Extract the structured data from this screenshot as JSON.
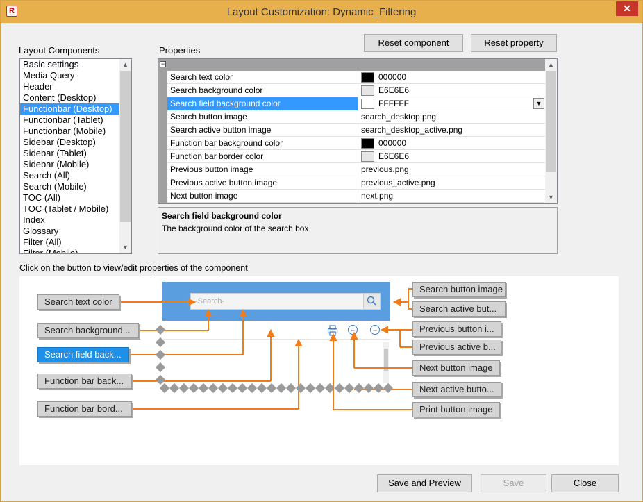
{
  "window": {
    "title": "Layout Customization: Dynamic_Filtering",
    "app_icon_letter": "R",
    "close_glyph": "✕"
  },
  "layout_components": {
    "label": "Layout Components",
    "items": [
      "Basic settings",
      "Media Query",
      "Header",
      "Content (Desktop)",
      "Functionbar (Desktop)",
      "Functionbar (Tablet)",
      "Functionbar (Mobile)",
      "Sidebar (Desktop)",
      "Sidebar (Tablet)",
      "Sidebar (Mobile)",
      "Search (All)",
      "Search (Mobile)",
      "TOC (All)",
      "TOC (Tablet / Mobile)",
      "Index",
      "Glossary",
      "Filter (All)",
      "Filter (Mobile)"
    ],
    "selected": "Functionbar (Desktop)"
  },
  "properties": {
    "label": "Properties",
    "reset_component": "Reset component",
    "reset_property": "Reset property",
    "collapse_glyph": "−",
    "rows": [
      {
        "name": "Search text color",
        "value": "000000",
        "swatch": "#000000"
      },
      {
        "name": "Search background color",
        "value": "E6E6E6",
        "swatch": "#e6e6e6"
      },
      {
        "name": "Search field background color",
        "value": "FFFFFF",
        "swatch": "#ffffff"
      },
      {
        "name": "Search button image",
        "value": "search_desktop.png"
      },
      {
        "name": "Search active button image",
        "value": "search_desktop_active.png"
      },
      {
        "name": "Function bar background color",
        "value": "000000",
        "swatch": "#000000"
      },
      {
        "name": "Function bar border color",
        "value": "E6E6E6",
        "swatch": "#e6e6e6"
      },
      {
        "name": "Previous button image",
        "value": "previous.png"
      },
      {
        "name": "Previous active button image",
        "value": "previous_active.png"
      },
      {
        "name": "Next button image",
        "value": "next.png"
      }
    ],
    "selected_row": "Search field background color",
    "dropdown_glyph": "▼",
    "description_title": "Search field background color",
    "description_text": "The background color of the search box."
  },
  "hint": "Click on the button to view/edit properties of the component",
  "preview": {
    "search_placeholder": "-Search-",
    "left_buttons": [
      "Search text color",
      "Search background...",
      "Search field back...",
      "Function bar back...",
      "Function bar bord..."
    ],
    "active_left": "Search field back...",
    "right_buttons": [
      "Search button image",
      "Search active but...",
      "Previous button i...",
      "Previous active b...",
      "Next button image",
      "Next active butto...",
      "Print button image"
    ]
  },
  "footer": {
    "save_preview": "Save and Preview",
    "save": "Save",
    "close": "Close"
  },
  "colors": {
    "accent": "#3399ff",
    "arrow": "#f07d1a",
    "titlebar": "#e8b04c"
  }
}
